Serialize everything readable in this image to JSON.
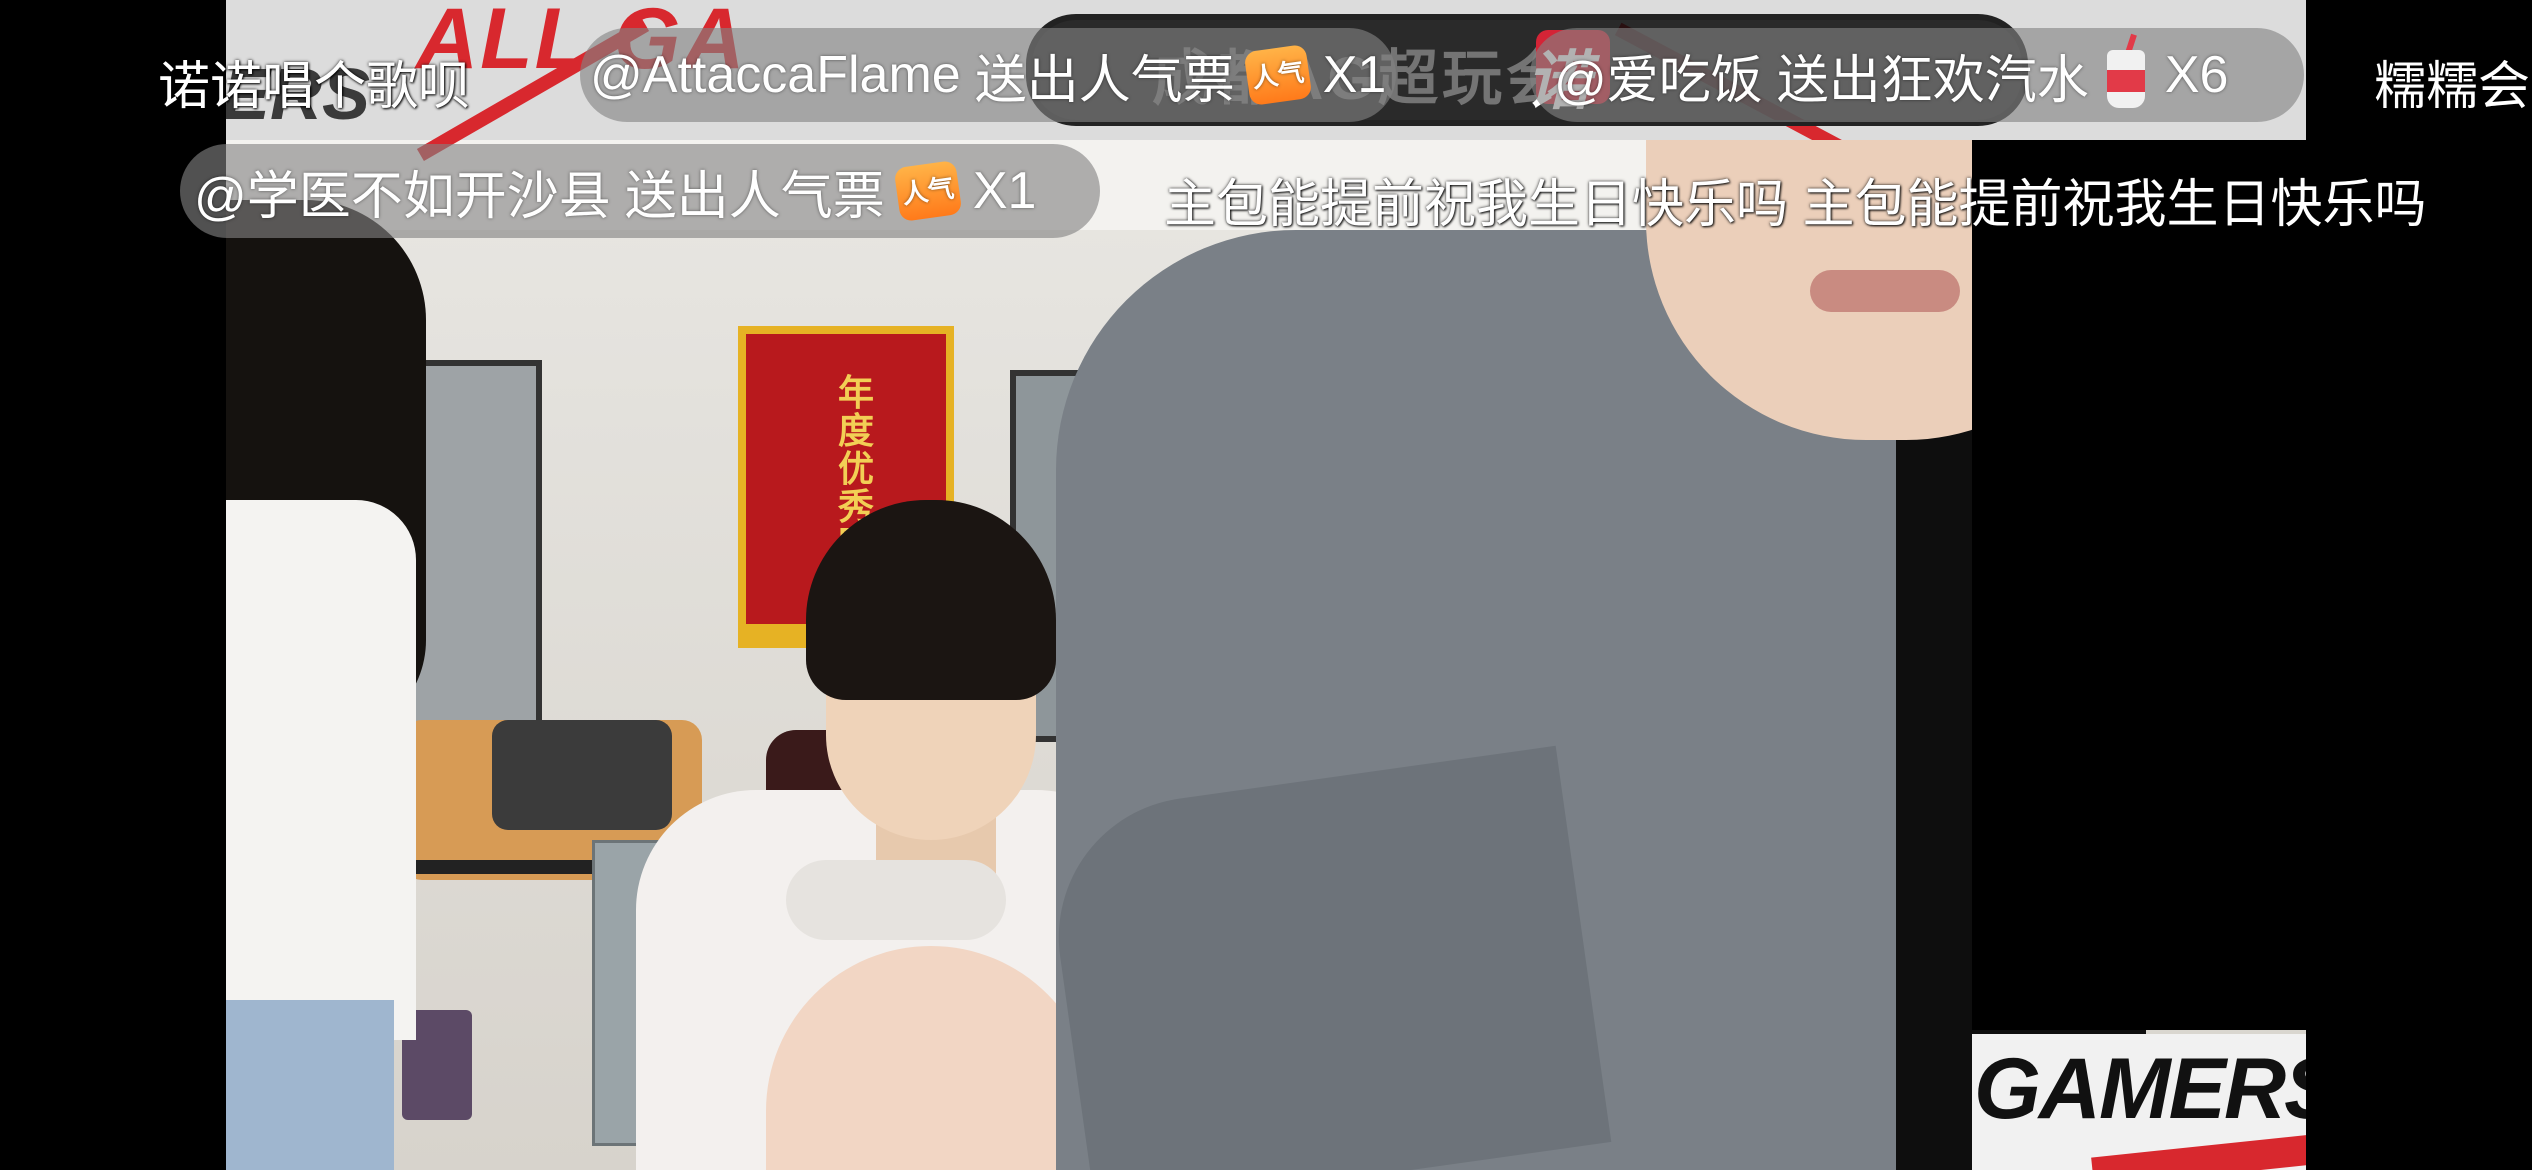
{
  "stream": {
    "room_title_overlay": "成都AG超玩会",
    "streamer_badge": "诺",
    "banner_logo": "ALL GA",
    "banner_corner": "ERS",
    "sticker_text": "GAMERS"
  },
  "pennant": {
    "text": "年度优秀团队"
  },
  "danmaku": {
    "row1_left": "诺诺唱个歌呗",
    "row1_right_partial": "糯糯会",
    "row2_right": "主包能提前祝我生日快乐吗 主包能提前祝我生日快乐吗"
  },
  "gifts": [
    {
      "user": "@AttaccaFlame",
      "action": "送出人气票",
      "icon": "popularity-ticket",
      "icon_label": "人气",
      "count": "X1"
    },
    {
      "user": "@爱吃饭",
      "action": "送出狂欢汽水",
      "icon": "carnival-soda",
      "count": "X6"
    },
    {
      "user": "@学医不如开沙县",
      "action": "送出人气票",
      "icon": "popularity-ticket",
      "icon_label": "人气",
      "count": "X1"
    }
  ],
  "colors": {
    "brand_red": "#d8282e",
    "ticket_orange": "#ff7a1a",
    "pill_bg": "rgba(130,130,130,0.62)"
  }
}
